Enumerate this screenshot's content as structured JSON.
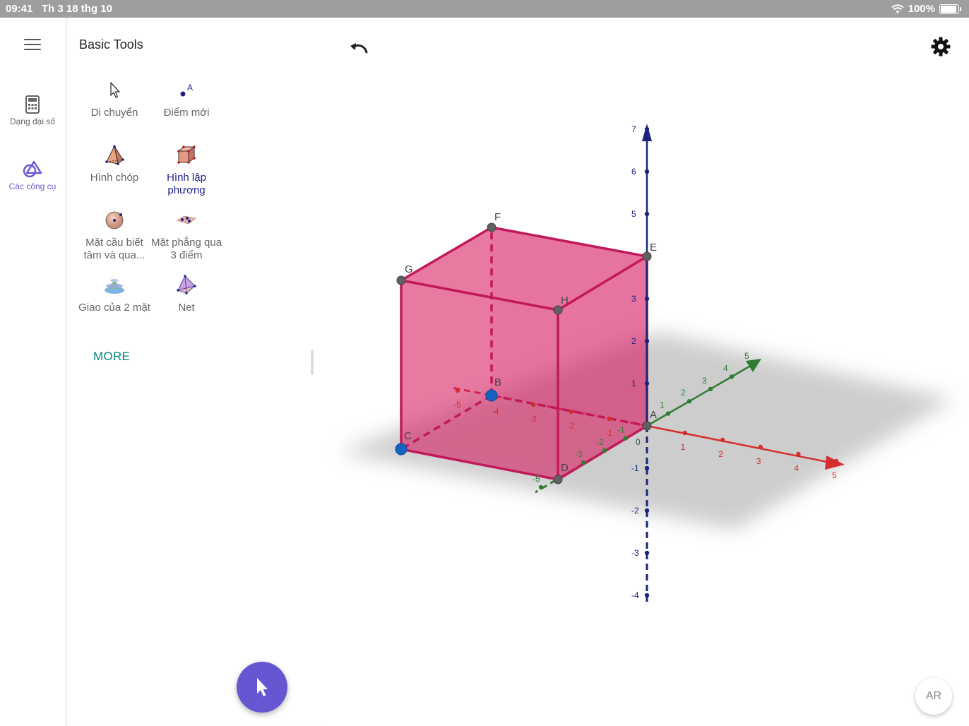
{
  "status_bar": {
    "time": "09:41",
    "date": "Th 3 18 thg 10",
    "battery": "100%",
    "battery_level": 1.0
  },
  "rail": {
    "menu_icon": "hamburger-menu-icon",
    "items": [
      {
        "label": "Dạng đại số",
        "icon": "calculator-icon",
        "active": false
      },
      {
        "label": "Các công cụ",
        "icon": "tools-icon",
        "active": true
      }
    ]
  },
  "panel": {
    "title": "Basic Tools",
    "tools": [
      {
        "label": "Di chuyển",
        "icon": "cursor-arrow-icon"
      },
      {
        "label": "Điểm mới",
        "icon": "new-point-icon",
        "glyph": "A"
      },
      {
        "label": "Hình chóp",
        "icon": "pyramid-icon"
      },
      {
        "label": "Hình lập phương",
        "icon": "cube-icon",
        "selected": true
      },
      {
        "label": "Mặt cầu biết tâm và qua...",
        "icon": "sphere-icon"
      },
      {
        "label": "Mặt phẳng qua 3 điểm",
        "icon": "plane-three-points-icon"
      },
      {
        "label": "Giao của 2 mặt",
        "icon": "intersect-surfaces-icon"
      },
      {
        "label": "Net",
        "icon": "net-icon"
      }
    ],
    "more_label": "MORE"
  },
  "toolbar": {
    "undo_icon": "undo-icon",
    "settings_icon": "gear-icon",
    "ar_label": "AR"
  },
  "fab": {
    "icon": "cursor-arrow-icon"
  },
  "graph": {
    "points": [
      "A",
      "B",
      "C",
      "D",
      "E",
      "F",
      "G",
      "H"
    ],
    "x_ticks": [
      "-5",
      "-4",
      "-3",
      "-2",
      "-1",
      "1",
      "2",
      "3",
      "4",
      "5"
    ],
    "y_ticks": [
      "-5",
      "-3",
      "-2",
      "-1",
      "1",
      "2",
      "3",
      "4",
      "5"
    ],
    "z_ticks": [
      "-4",
      "-3",
      "-2",
      "-1",
      "1",
      "2",
      "3",
      "5",
      "6",
      "7"
    ],
    "origin_label": "0",
    "colors": {
      "x_axis": "#d32f2f",
      "y_axis": "#2e7d32",
      "z_axis": "#1a237e",
      "cube": "#d81b60",
      "accent": "#6557d2"
    }
  }
}
